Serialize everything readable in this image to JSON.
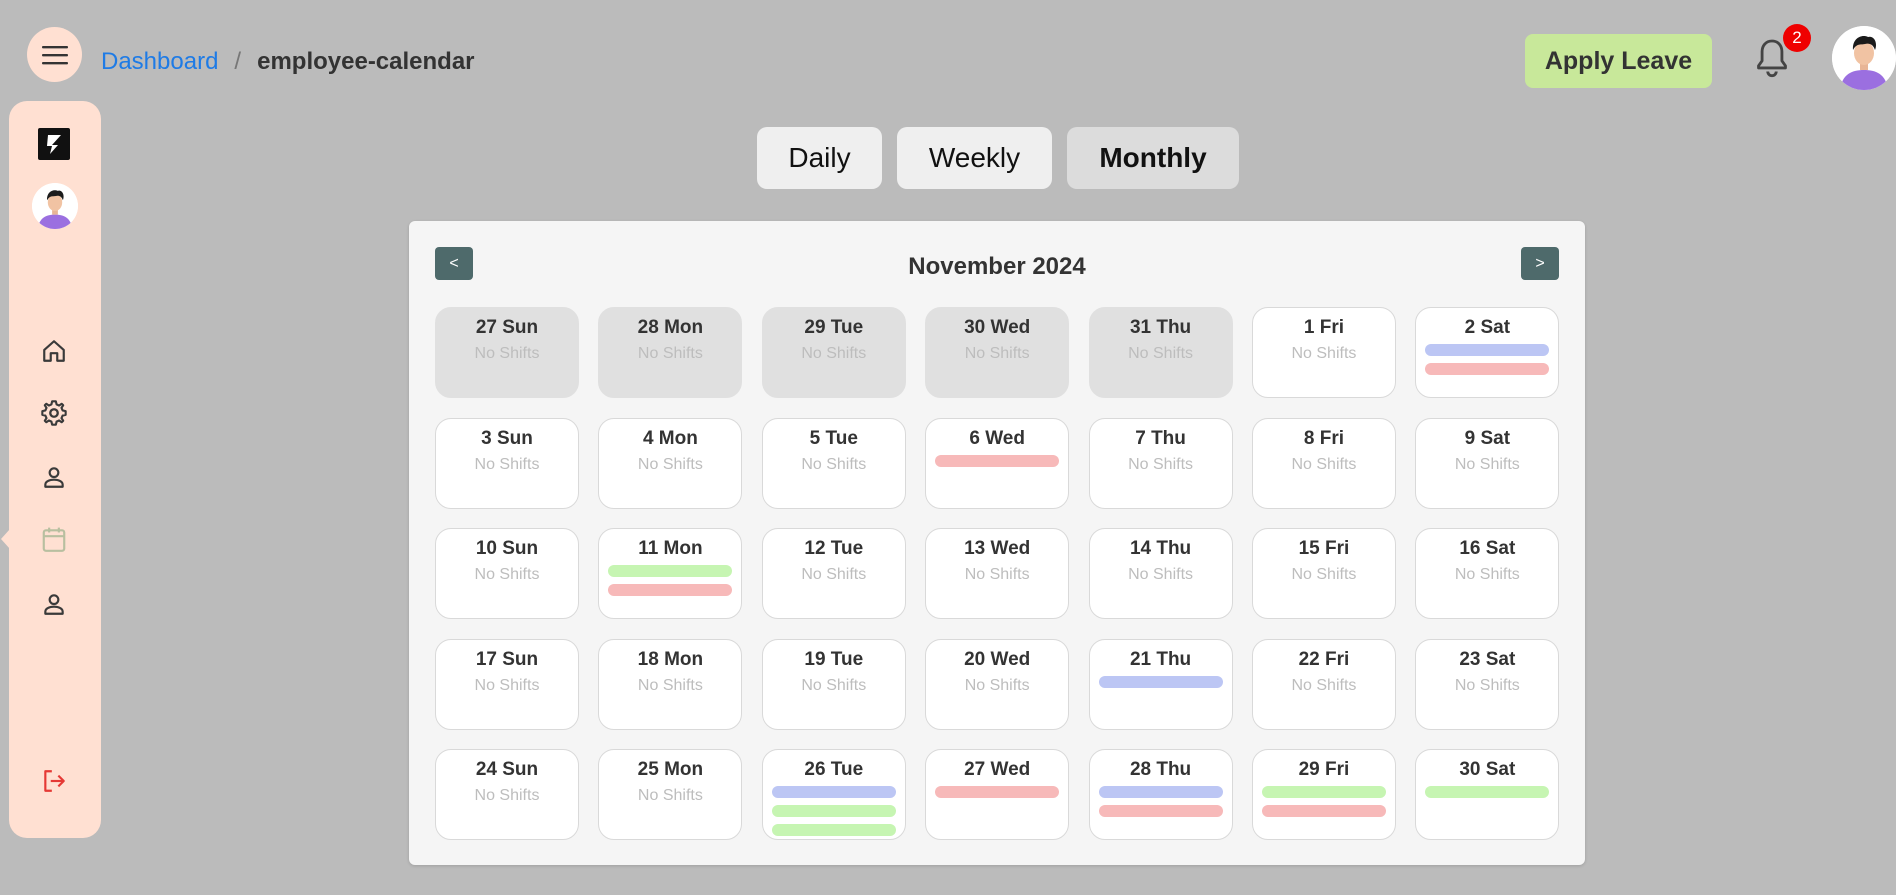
{
  "header": {
    "menu_icon": "hamburger-menu-icon",
    "breadcrumb": {
      "link": "Dashboard",
      "separator": "/",
      "current": "employee-calendar"
    },
    "apply_leave_label": "Apply Leave",
    "notification_count": "2",
    "bell_icon": "bell-icon"
  },
  "sidebar": {
    "items": [
      {
        "icon": "home-icon"
      },
      {
        "icon": "gear-icon"
      },
      {
        "icon": "user-icon"
      },
      {
        "icon": "calendar-icon",
        "active": true
      },
      {
        "icon": "user-icon"
      },
      {
        "icon": "logout-icon"
      }
    ]
  },
  "view_tabs": [
    {
      "label": "Daily"
    },
    {
      "label": "Weekly"
    },
    {
      "label": "Monthly",
      "active": true
    }
  ],
  "calendar": {
    "prev_label": "<",
    "next_label": ">",
    "month_title": "November 2024",
    "no_shifts_text": "No Shifts",
    "colors": {
      "blue": "#bcc6f4",
      "red": "#f7b9b9",
      "green": "#c6f5b2"
    },
    "days": [
      {
        "label": "27 Sun",
        "other": true,
        "shifts": []
      },
      {
        "label": "28 Mon",
        "other": true,
        "shifts": []
      },
      {
        "label": "29 Tue",
        "other": true,
        "shifts": []
      },
      {
        "label": "30 Wed",
        "other": true,
        "shifts": []
      },
      {
        "label": "31 Thu",
        "other": true,
        "shifts": []
      },
      {
        "label": "1 Fri",
        "shifts": []
      },
      {
        "label": "2 Sat",
        "shifts": [
          "blue",
          "red"
        ]
      },
      {
        "label": "3 Sun",
        "shifts": []
      },
      {
        "label": "4 Mon",
        "shifts": []
      },
      {
        "label": "5 Tue",
        "shifts": []
      },
      {
        "label": "6 Wed",
        "shifts": [
          "red"
        ]
      },
      {
        "label": "7 Thu",
        "shifts": []
      },
      {
        "label": "8 Fri",
        "shifts": []
      },
      {
        "label": "9 Sat",
        "shifts": []
      },
      {
        "label": "10 Sun",
        "shifts": []
      },
      {
        "label": "11 Mon",
        "shifts": [
          "green",
          "red"
        ]
      },
      {
        "label": "12 Tue",
        "shifts": []
      },
      {
        "label": "13 Wed",
        "shifts": []
      },
      {
        "label": "14 Thu",
        "shifts": []
      },
      {
        "label": "15 Fri",
        "shifts": []
      },
      {
        "label": "16 Sat",
        "shifts": []
      },
      {
        "label": "17 Sun",
        "shifts": []
      },
      {
        "label": "18 Mon",
        "shifts": []
      },
      {
        "label": "19 Tue",
        "shifts": []
      },
      {
        "label": "20 Wed",
        "shifts": []
      },
      {
        "label": "21 Thu",
        "shifts": [
          "blue"
        ]
      },
      {
        "label": "22 Fri",
        "shifts": []
      },
      {
        "label": "23 Sat",
        "shifts": []
      },
      {
        "label": "24 Sun",
        "shifts": []
      },
      {
        "label": "25 Mon",
        "shifts": []
      },
      {
        "label": "26 Tue",
        "shifts": [
          "blue",
          "green",
          "green"
        ]
      },
      {
        "label": "27 Wed",
        "shifts": [
          "red"
        ]
      },
      {
        "label": "28 Thu",
        "shifts": [
          "blue",
          "red"
        ]
      },
      {
        "label": "29 Fri",
        "shifts": [
          "green",
          "red"
        ]
      },
      {
        "label": "30 Sat",
        "shifts": [
          "green"
        ]
      }
    ]
  }
}
